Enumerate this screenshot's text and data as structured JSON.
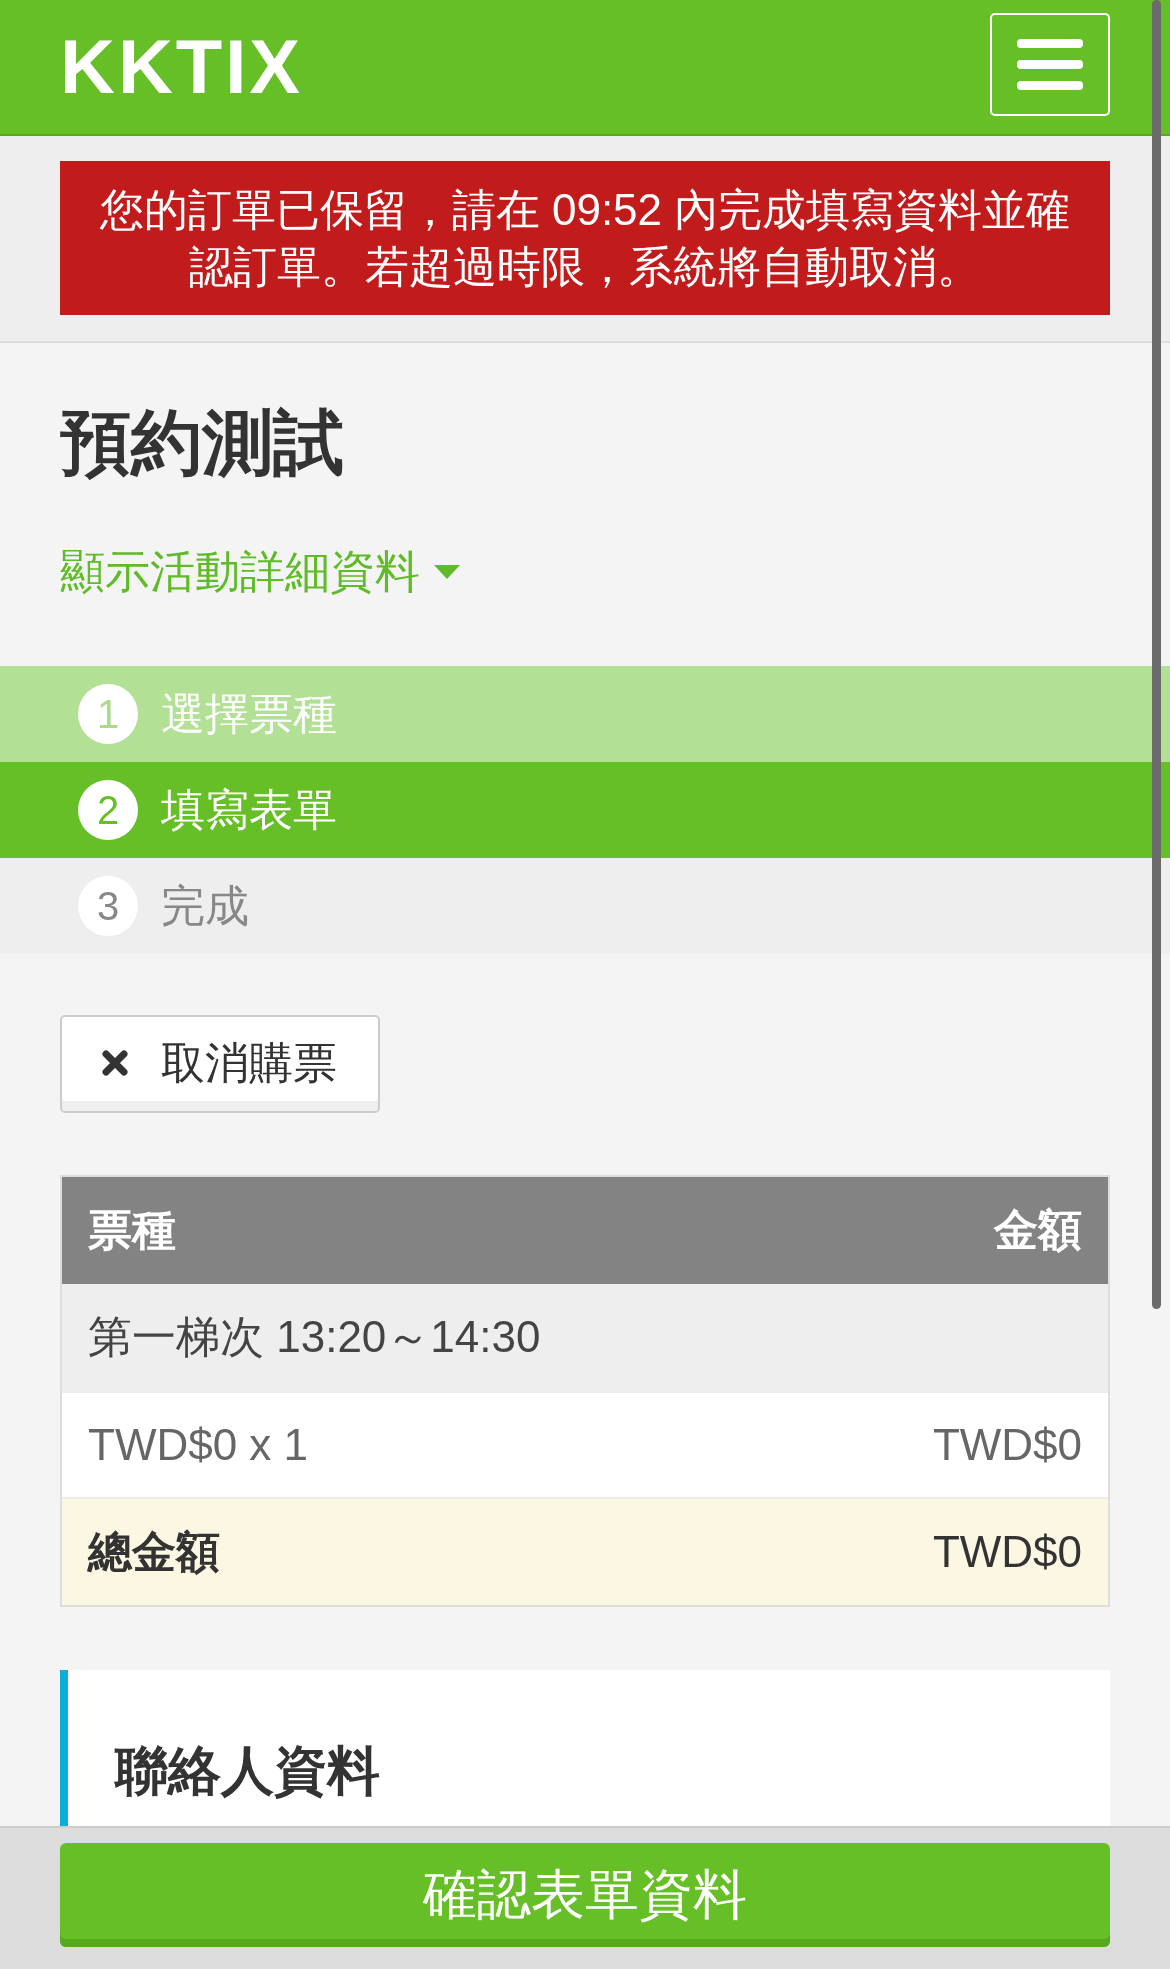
{
  "header": {
    "logo": "KKTIX"
  },
  "alert": {
    "text": "您的訂單已保留，請在 09:52 內完成填寫資料並確認訂單。若超過時限，系統將自動取消。"
  },
  "event": {
    "title": "預約測試",
    "details_link": {
      "label": "顯示活動詳細資料",
      "expanded": false
    }
  },
  "steps": [
    {
      "number": "1",
      "label": "選擇票種",
      "completed": true,
      "active": false
    },
    {
      "number": "2",
      "label": "填寫表單",
      "completed": false,
      "active": true
    },
    {
      "number": "3",
      "label": "完成",
      "completed": false,
      "active": false
    }
  ],
  "cancel_button": {
    "label": "取消購票"
  },
  "table": {
    "columns": [
      "票種",
      "金額"
    ],
    "groups": [
      {
        "title": "第一梯次 13:20～14:30",
        "rows": [
          {
            "item": "TWD$0 x 1",
            "amount": "TWD$0"
          }
        ]
      }
    ],
    "total": {
      "label": "總金額",
      "amount": "TWD$0"
    }
  },
  "contact_section": {
    "title": "聯絡人資料"
  },
  "submit_button": {
    "label": "確認表單資料"
  }
}
